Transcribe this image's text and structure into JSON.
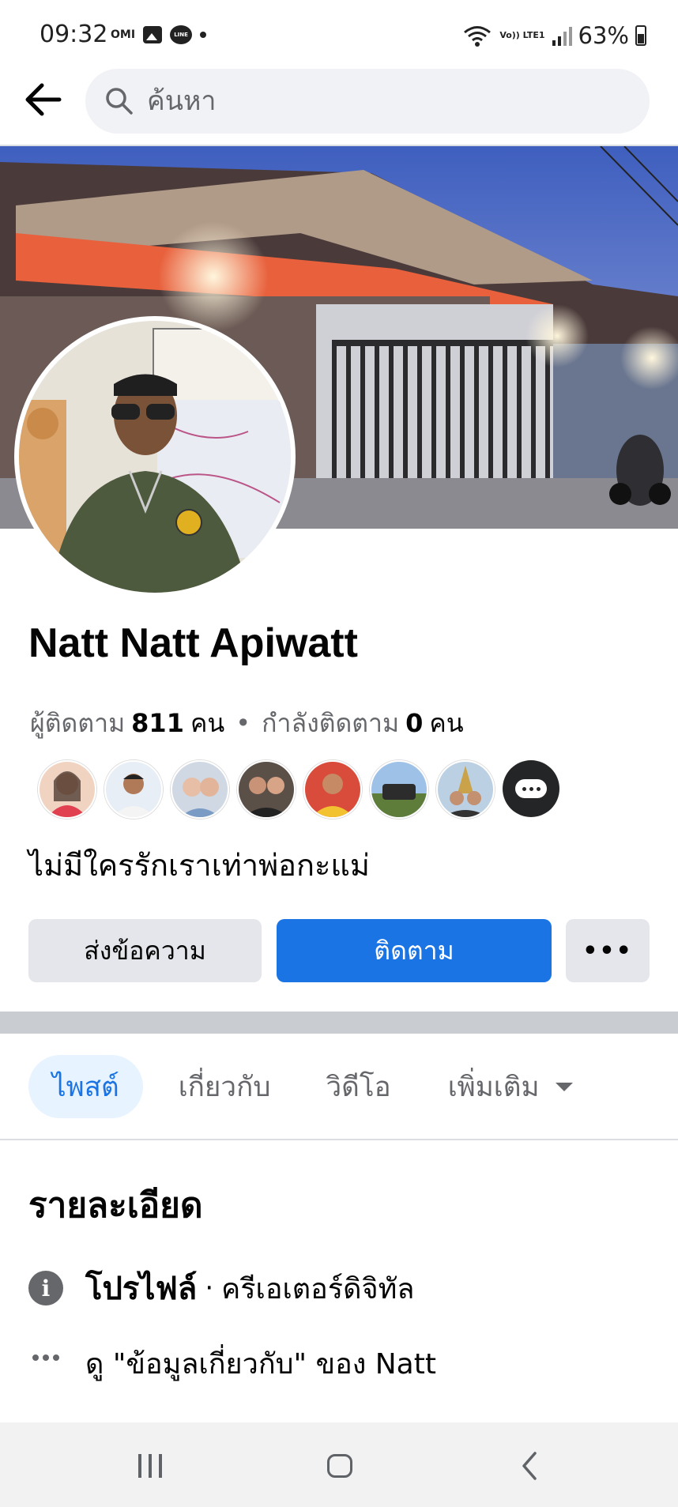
{
  "status_bar": {
    "time": "09:32",
    "omi_label": "OMI",
    "line_label": "LINE",
    "volte_label": "Vo)) LTE1",
    "battery": "63%"
  },
  "search": {
    "placeholder": "ค้นหา"
  },
  "profile": {
    "name": "Natt Natt Apiwatt",
    "followers_label": "ผู้ติดตาม",
    "followers_count": "811",
    "followers_unit": "คน",
    "following_label": "กำลังติดตาม",
    "following_count": "0",
    "following_unit": "คน",
    "bio": "ไม่มีใครรักเราเท่าพ่อกะแม่"
  },
  "actions": {
    "message": "ส่งข้อความ",
    "follow": "ติดตาม",
    "more": "•••"
  },
  "tabs": {
    "posts": "ไพสต์",
    "about": "เกี่ยวกับ",
    "videos": "วิดีโอ",
    "more": "เพิ่มเติม"
  },
  "details": {
    "title": "รายละเอียด",
    "profile_label": "โปรไฟล์",
    "profile_separator": "·",
    "profile_value": "ครีเอเตอร์ดิจิทัล",
    "about_link": "ดู \"ข้อมูลเกี่ยวกับ\" ของ Natt"
  },
  "colors": {
    "accent": "#1b74e4",
    "secondary_text": "#65676b",
    "button_gray": "#e4e6eb"
  }
}
